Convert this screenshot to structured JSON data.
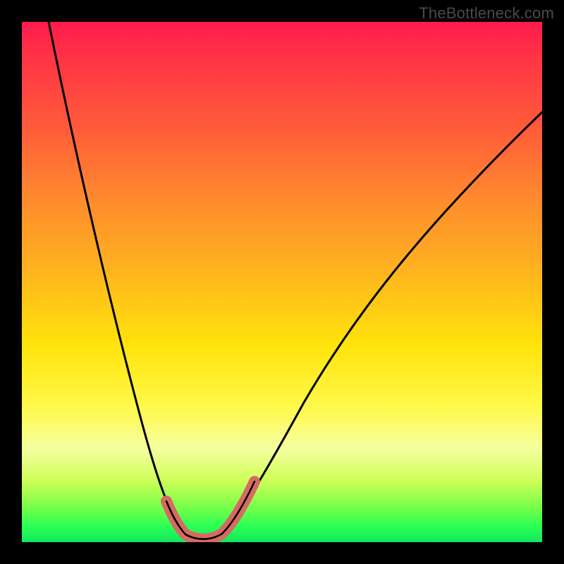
{
  "watermark": "TheBottleneck.com",
  "chart_data": {
    "type": "line",
    "title": "",
    "xlabel": "",
    "ylabel": "",
    "xlim": [
      0,
      1
    ],
    "ylim": [
      0,
      1
    ],
    "series": [
      {
        "name": "bottleneck-curve",
        "x": [
          0.0,
          0.05,
          0.1,
          0.15,
          0.2,
          0.25,
          0.27,
          0.29,
          0.31,
          0.33,
          0.36,
          0.4,
          0.45,
          0.5,
          0.55,
          0.6,
          0.7,
          0.8,
          0.9,
          1.0
        ],
        "values": [
          1.05,
          0.92,
          0.78,
          0.62,
          0.42,
          0.17,
          0.08,
          0.03,
          0.02,
          0.02,
          0.04,
          0.1,
          0.2,
          0.3,
          0.39,
          0.47,
          0.6,
          0.7,
          0.78,
          0.85
        ]
      }
    ],
    "marker_segments": [
      {
        "range": "left-wall",
        "stroke": "#d66a63"
      },
      {
        "range": "valley",
        "stroke": "#d66a63"
      },
      {
        "range": "right-wall",
        "stroke": "#d66a63"
      }
    ],
    "colors": {
      "curve_black": "#000000",
      "curve_salmon": "#d66a63"
    }
  }
}
